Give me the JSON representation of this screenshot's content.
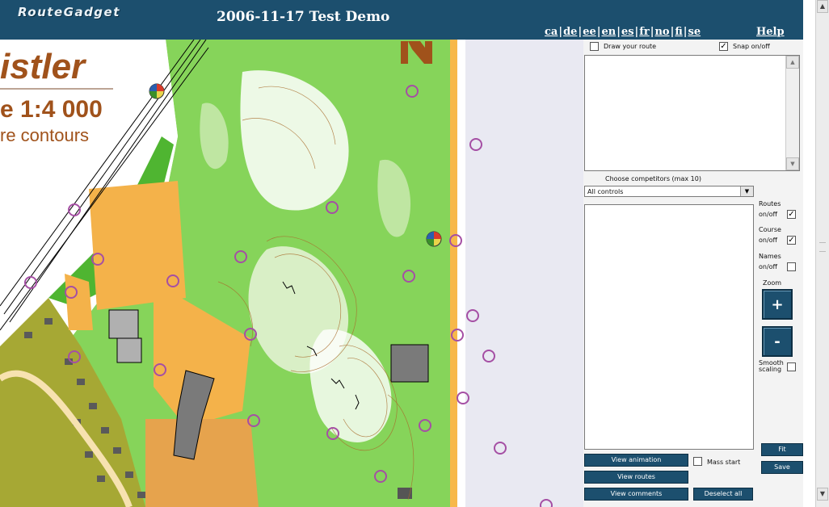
{
  "header": {
    "logo": "RouteGadget",
    "title": "2006-11-17 Test Demo",
    "languages": [
      "ca",
      "de",
      "ee",
      "en",
      "es",
      "fr",
      "no",
      "fi",
      "se"
    ],
    "help": "Help"
  },
  "map": {
    "name_fragment": "istler",
    "scale_fragment": "e 1:4 000",
    "contours_fragment": "re contours",
    "colors": {
      "forest": "#86d45a",
      "open": "#f4b24a",
      "rough": "#a6a834",
      "control": "#a54fa4",
      "road": "#f7b84a"
    }
  },
  "panel": {
    "draw_route_label": "Draw your route",
    "snap_label": "Snap on/off",
    "snap_checked": true,
    "draw_checked": false,
    "choose_label": "Choose competitors (max 10)",
    "course_select": "All controls",
    "routes": {
      "label1": "Routes",
      "label2": "on/off",
      "checked": true
    },
    "course": {
      "label1": "Course",
      "label2": "on/off",
      "checked": true
    },
    "names": {
      "label1": "Names",
      "label2": "on/off",
      "checked": false
    },
    "zoom_label": "Zoom",
    "zoom_in": "+",
    "zoom_out": "-",
    "smooth_label1": "Smooth",
    "smooth_label2": "scaling",
    "smooth_checked": false,
    "view_animation": "View animation",
    "mass_start": "Mass start",
    "mass_start_checked": false,
    "view_routes": "View routes",
    "view_comments": "View comments",
    "deselect_all": "Deselect all",
    "fit": "Fit",
    "save": "Save"
  }
}
